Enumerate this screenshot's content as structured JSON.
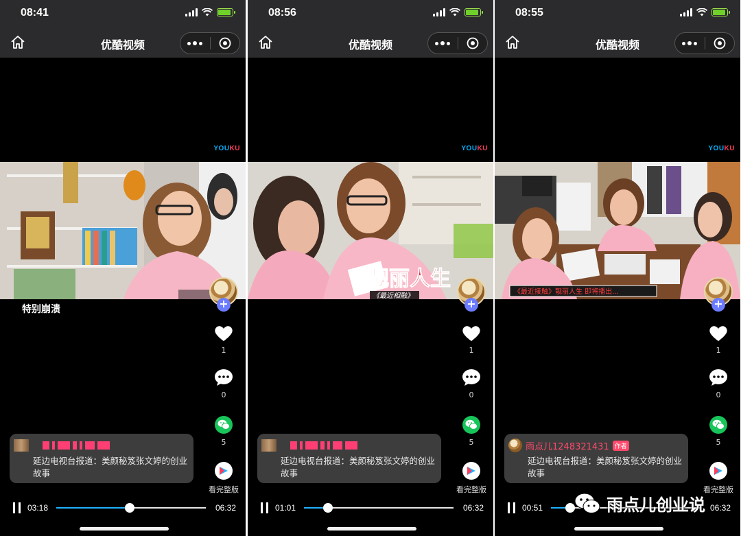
{
  "app": {
    "title": "优酷视频"
  },
  "panels": [
    {
      "status_time": "08:41",
      "subtitle": "特别崩溃",
      "video_caption": "",
      "video_caption2": "",
      "likes": "1",
      "comments": "0",
      "shares": "5",
      "full_version": "看完整版",
      "author_visible": false,
      "author": "",
      "author_badge": "",
      "description": "延边电视台报道：美颜秘笈张文婷的创业故事",
      "current_time": "03:18",
      "total_time": "06:32",
      "progress": 0.49
    },
    {
      "status_time": "08:56",
      "subtitle": "",
      "video_caption": "靓丽人生",
      "video_caption2": "《最近相融》",
      "likes": "1",
      "comments": "0",
      "shares": "5",
      "full_version": "看完整版",
      "author_visible": false,
      "author": "",
      "author_badge": "",
      "description": "延边电视台报道：美颜秘笈张文婷的创业故事",
      "current_time": "01:01",
      "total_time": "06:32",
      "progress": 0.16
    },
    {
      "status_time": "08:55",
      "subtitle": "",
      "video_caption": "《最近接触》靓丽人生 即将播出...",
      "video_caption2": "",
      "likes": "1",
      "comments": "0",
      "shares": "5",
      "full_version": "看完整版",
      "author_visible": true,
      "author": "雨点儿1248321431",
      "author_badge": "作者",
      "description": "延边电视台报道：美颜秘笈张文婷的创业故事",
      "current_time": "00:51",
      "total_time": "06:32",
      "progress": 0.13
    }
  ],
  "watermark": {
    "text": "雨点儿创业说"
  },
  "colors": {
    "accent": "#1fb3ff",
    "author": "#ff4a6c",
    "wechat": "#18c55a"
  }
}
